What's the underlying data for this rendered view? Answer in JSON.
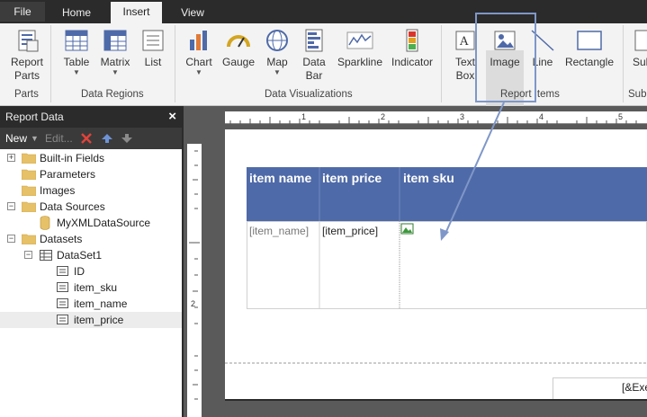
{
  "tabs": {
    "file": "File",
    "home": "Home",
    "insert": "Insert",
    "view": "View"
  },
  "ribbon": {
    "report_parts": {
      "line1": "Report",
      "line2": "Parts"
    },
    "groups": {
      "parts": "Parts",
      "data_regions": "Data Regions",
      "data_visualizations": "Data Visualizations",
      "report_items": "Report Items",
      "subreports": "Subr"
    },
    "table": "Table",
    "matrix": "Matrix",
    "list": "List",
    "chart": "Chart",
    "gauge": "Gauge",
    "map": "Map",
    "data_bar": {
      "line1": "Data",
      "line2": "Bar"
    },
    "sparkline": "Sparkline",
    "indicator": "Indicator",
    "text_box": {
      "line1": "Text",
      "line2": "Box"
    },
    "image": "Image",
    "line": "Line",
    "rectangle": "Rectangle",
    "subreport": "Sub"
  },
  "panel": {
    "title": "Report Data",
    "close": "×",
    "tools": {
      "new": "New",
      "edit": "Edit..."
    },
    "tree": {
      "builtin": "Built-in Fields",
      "parameters": "Parameters",
      "images": "Images",
      "data_sources": "Data Sources",
      "datasource": "MyXMLDataSource",
      "datasets": "Datasets",
      "dataset1": "DataSet1",
      "fields": [
        "ID",
        "item_sku",
        "item_name",
        "item_price"
      ]
    }
  },
  "ruler": {
    "h": [
      "1",
      "2",
      "3",
      "4",
      "5"
    ],
    "v": "2"
  },
  "tablix": {
    "headers": [
      "item name",
      "item price",
      "item sku"
    ],
    "cells": [
      "[item_name]",
      "[item_price]"
    ]
  },
  "footer": {
    "exec": "[&Exe"
  },
  "colors": {
    "accent": "#4f6aa8",
    "callout": "#7f97c8",
    "dark_chrome": "#2b2b2b"
  }
}
